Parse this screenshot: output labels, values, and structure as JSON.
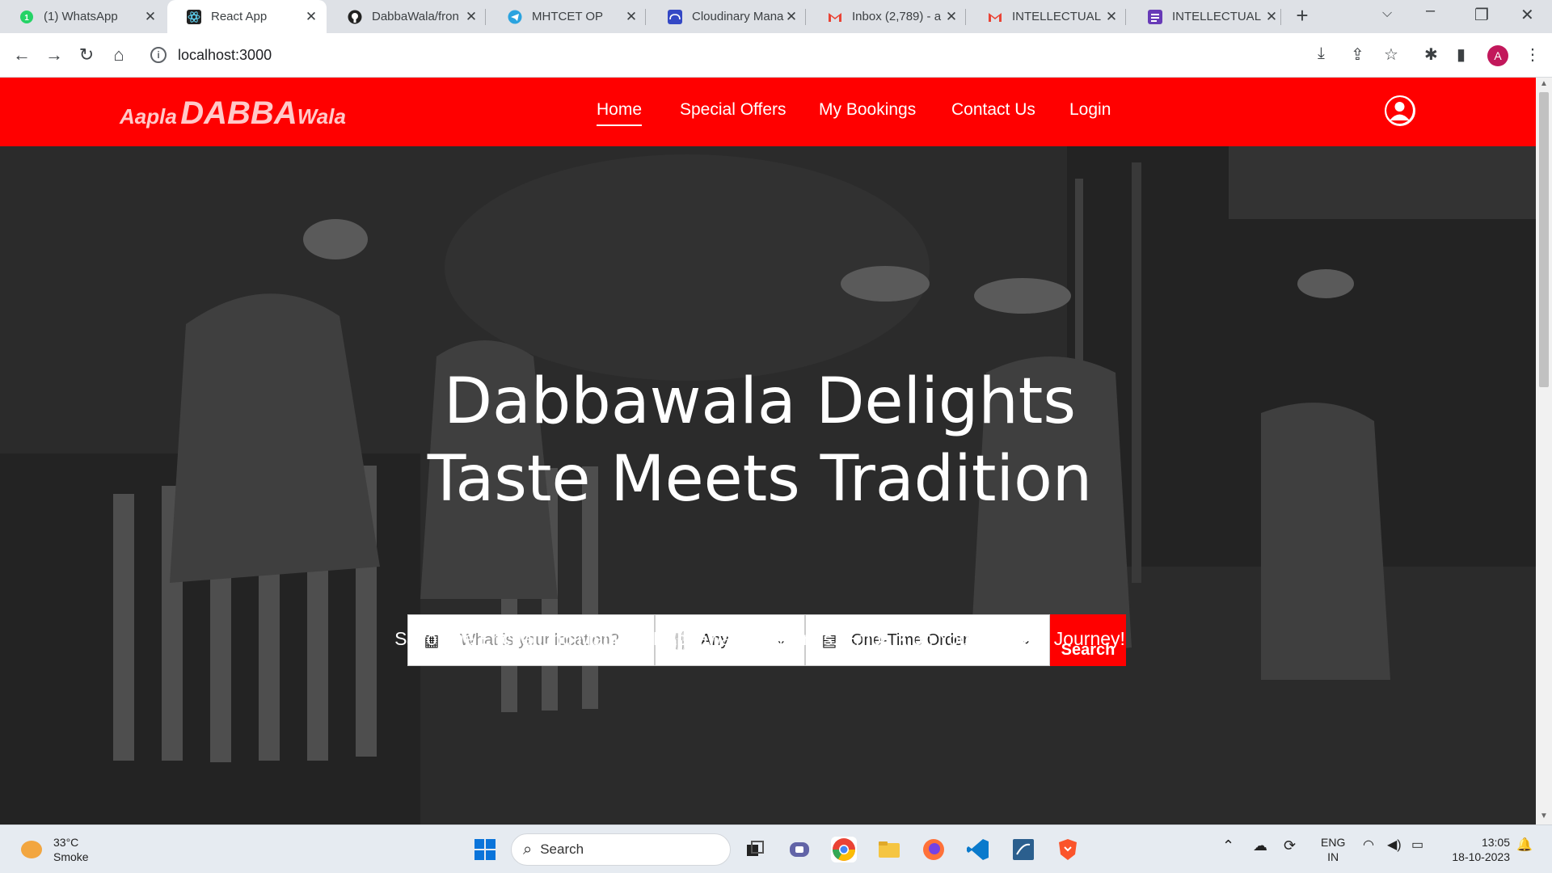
{
  "browser": {
    "tabs": [
      {
        "title": "(1) WhatsApp",
        "favicon_icon": "whatsapp-icon",
        "favicon_color": "#25d366",
        "active": false
      },
      {
        "title": "React App",
        "favicon_icon": "react-icon",
        "favicon_color": "#222222",
        "active": true
      },
      {
        "title": "DabbaWala/fron",
        "favicon_icon": "github-icon",
        "favicon_color": "#222222",
        "active": false
      },
      {
        "title": "MHTCET OP",
        "favicon_icon": "telegram-icon",
        "favicon_color": "#2aa3df",
        "active": false
      },
      {
        "title": "Cloudinary Mana",
        "favicon_icon": "cloudinary-icon",
        "favicon_color": "#3448c5",
        "active": false
      },
      {
        "title": "Inbox (2,789) - a",
        "favicon_icon": "gmail-icon",
        "favicon_color": "#ea4335",
        "active": false
      },
      {
        "title": "INTELLECTUAL P",
        "favicon_icon": "gmail-icon",
        "favicon_color": "#ea4335",
        "active": false
      },
      {
        "title": "INTELLECTUAL P",
        "favicon_icon": "forms-icon",
        "favicon_color": "#673ab7",
        "active": false
      }
    ],
    "url": "localhost:3000",
    "profile_initial": "A"
  },
  "site": {
    "logo": {
      "prefix": "Aapla",
      "main": "DABBA",
      "suffix": "Wala"
    },
    "nav": [
      {
        "label": "Home",
        "active": true
      },
      {
        "label": "Special Offers",
        "active": false
      },
      {
        "label": "My Bookings",
        "active": false
      },
      {
        "label": "Contact Us",
        "active": false
      },
      {
        "label": "Login",
        "active": false
      }
    ],
    "user_icon": "user-circle-icon",
    "accent": "#ff0000"
  },
  "hero": {
    "title_line1": "Dabbawala Delights",
    "title_line2": "Taste Meets Tradition",
    "search": {
      "location_placeholder": "What is your location?",
      "location_icon": "building-icon",
      "cuisine_value": "Any",
      "cuisine_icon": "utensils-icon",
      "order_value": "One-Time Order",
      "order_icon": "calendar-icon",
      "button_label": "Search"
    },
    "subtitle": "Savor the Enchanting Magic of Dabbawala Deliveries. Embark on Your Culinary Journey!"
  },
  "taskbar": {
    "weather_temp": "33°C",
    "weather_desc": "Smoke",
    "search_label": "Search",
    "lang_top": "ENG",
    "lang_bottom": "IN",
    "time": "13:05",
    "date": "18-10-2023"
  }
}
